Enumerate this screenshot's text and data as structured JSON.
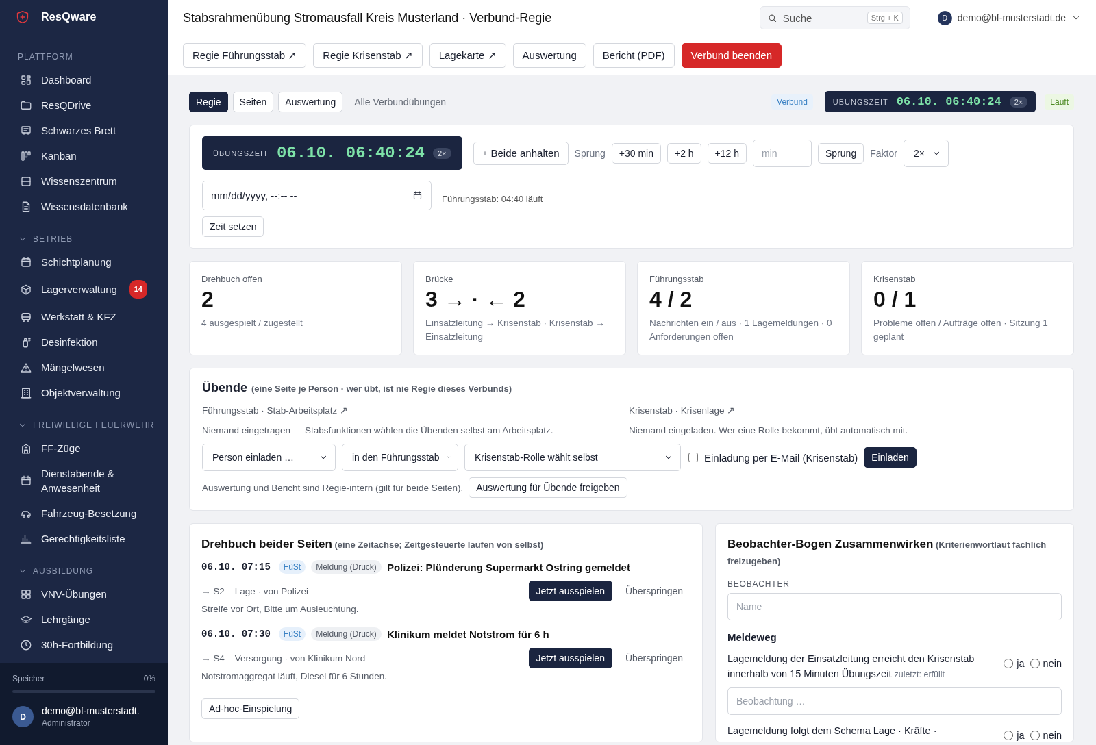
{
  "sidebar": {
    "brand": "ResQware",
    "sections": [
      {
        "kind": "plain",
        "title": "PLATTFORM",
        "items": [
          {
            "label": "Dashboard"
          },
          {
            "label": "ResQDrive"
          },
          {
            "label": "Schwarzes Brett"
          },
          {
            "label": "Kanban"
          },
          {
            "label": "Wissenszentrum"
          },
          {
            "label": "Wissensdatenbank"
          }
        ]
      },
      {
        "kind": "group",
        "title": "BETRIEB",
        "expanded": true,
        "items": [
          {
            "label": "Schichtplanung"
          },
          {
            "label": "Lagerverwaltung",
            "badge": "14"
          },
          {
            "label": "Werkstatt & KFZ"
          },
          {
            "label": "Desinfektion"
          },
          {
            "label": "Mängelwesen"
          },
          {
            "label": "Objektverwaltung"
          }
        ]
      },
      {
        "kind": "group",
        "title": "FREIWILLIGE FEUERWEHR",
        "expanded": true,
        "items": [
          {
            "label": "FF-Züge"
          },
          {
            "label": "Dienstabende & Anwesenheit"
          },
          {
            "label": "Fahrzeug-Besetzung"
          },
          {
            "label": "Gerechtigkeitsliste"
          }
        ]
      },
      {
        "kind": "group",
        "title": "AUSBILDUNG",
        "expanded": true,
        "items": [
          {
            "label": "VNV-Übungen"
          },
          {
            "label": "Lehrgänge"
          },
          {
            "label": "30h-Fortbildung"
          }
        ]
      }
    ],
    "storage": {
      "label": "Speicher",
      "reading": "0%",
      "level": 0
    },
    "user": {
      "initial": "D",
      "name": "demo@bf-musterstadt.",
      "role": "Administrator"
    }
  },
  "header": {
    "title": "Stabsrahmenübung Stromausfall Kreis Musterland · Verbund-Regie",
    "search": {
      "placeholder": "Suche",
      "shortcut": "Strg + K"
    },
    "user": {
      "initial": "D",
      "email": "demo@bf-musterstadt.de"
    }
  },
  "toolbar": [
    {
      "label": "Regie Führungsstab ↗",
      "kind": "plain"
    },
    {
      "label": "Regie Krisenstab ↗",
      "kind": "plain"
    },
    {
      "label": "Lagekarte ↗",
      "kind": "plain"
    },
    {
      "label": "Auswertung",
      "kind": "plain"
    },
    {
      "label": "Bericht (PDF)",
      "kind": "plain"
    },
    {
      "label": "Verbund beenden",
      "kind": "danger"
    }
  ],
  "tabs": [
    {
      "label": "Regie",
      "selected": true
    },
    {
      "label": "Seiten",
      "selected": false
    },
    {
      "label": "Auswertung",
      "selected": false
    }
  ],
  "all_link": "Alle Verbundübungen",
  "status": {
    "scope": "Verbund",
    "clock": {
      "label": "ÜBUNGSZEIT",
      "time": "06.10. 06:40:24",
      "factor": "2×"
    },
    "state": "Läuft"
  },
  "control": {
    "clock": {
      "label": "ÜBUNGSZEIT",
      "time": "06.10. 06:40:24",
      "factor": "2×"
    },
    "pause": "Beide anhalten",
    "jump_label": "Sprung",
    "jumps": [
      "+30 min",
      "+2 h",
      "+12 h"
    ],
    "minutes_placeholder": "min",
    "jump_button": "Sprung",
    "factor_label": "Faktor",
    "factor_value": "2×",
    "datetime_placeholder": "mm/dd/yyyy, --:-- --",
    "set_button": "Zeit setzen",
    "note": "Führungsstab: 04:40 läuft"
  },
  "stats": [
    {
      "label": "Drehbuch offen",
      "value": "2",
      "detail": "4 ausgespielt / zugestellt"
    },
    {
      "label": "Brücke",
      "value": "3 → · ← 2",
      "detail": "Einsatzleitung → Krisenstab · Krisenstab → Einsatzleitung"
    },
    {
      "label": "Führungsstab",
      "value": "4 / 2",
      "detail": "Nachrichten ein / aus · 1 Lagemeldungen · 0 Anforderungen offen"
    },
    {
      "label": "Krisenstab",
      "value": "0 / 1",
      "detail": "Probleme offen / Aufträge offen · Sitzung 1 geplant"
    }
  ],
  "participants": {
    "title": "Übende",
    "subtitle": "(eine Seite je Person · wer übt, ist nie Regie dieses Verbunds)",
    "columns": [
      {
        "link": "Führungsstab · Stab-Arbeitsplatz ↗",
        "note": "Niemand eingetragen — Stabsfunktionen wählen die Übenden selbst am Arbeitsplatz."
      },
      {
        "link": "Krisenstab · Krisenlage ↗",
        "note": "Niemand eingeladen. Wer eine Rolle bekommt, übt automatisch mit."
      }
    ],
    "selects": [
      "Person einladen …",
      "in den Führungsstab",
      "Krisenstab-Rolle wählt selbst"
    ],
    "email_option": {
      "label": "Einladung per E-Mail (Krisenstab)",
      "checked": false
    },
    "invite_button": "Einladen",
    "footer_note": "Auswertung und Bericht sind Regie-intern (gilt für beide Seiten).",
    "release_button": "Auswertung für Übende freigeben"
  },
  "script": {
    "title": "Drehbuch beider Seiten",
    "subtitle": "(eine Zeitachse; Zeitgesteuerte laufen von selbst)",
    "entries": [
      {
        "time": "06.10. 07:15",
        "side": "FüSt",
        "type": "Meldung (Druck)",
        "headline": "Polizei: Plünderung Supermarkt Ostring gemeldet",
        "route": "→ S2 – Lage · von Polizei",
        "body": "Streife vor Ort, Bitte um Ausleuchtung.",
        "play": "Jetzt ausspielen",
        "skip": "Überspringen"
      },
      {
        "time": "06.10. 07:30",
        "side": "FüSt",
        "type": "Meldung (Druck)",
        "headline": "Klinikum meldet Notstrom für 6 h",
        "route": "→ S4 – Versorgung · von Klinikum Nord",
        "body": "Notstromaggregat läuft, Diesel für 6 Stunden.",
        "play": "Jetzt ausspielen",
        "skip": "Überspringen"
      }
    ],
    "adhoc_button": "Ad-hoc-Einspielung"
  },
  "observer": {
    "title": "Beobachter-Bogen Zusammenwirken",
    "subtitle": "(Kriterienwortlaut fachlich freizugeben)",
    "field_label": "BEOBACHTER",
    "name_placeholder": "Name",
    "section": "Meldeweg",
    "criteria": [
      {
        "text": "Lagemeldung der Einsatzleitung erreicht den Krisenstab innerhalb von 15 Minuten Übungszeit",
        "note": "zuletzt: erfüllt",
        "options": [
          {
            "label": "ja",
            "selected": false
          },
          {
            "label": "nein",
            "selected": false
          }
        ],
        "placeholder": "Beobachtung …"
      },
      {
        "text": "Lagemeldung folgt dem Schema Lage · Kräfte ·",
        "options": [
          {
            "label": "ja",
            "selected": false
          },
          {
            "label": "nein",
            "selected": false
          }
        ]
      }
    ]
  }
}
